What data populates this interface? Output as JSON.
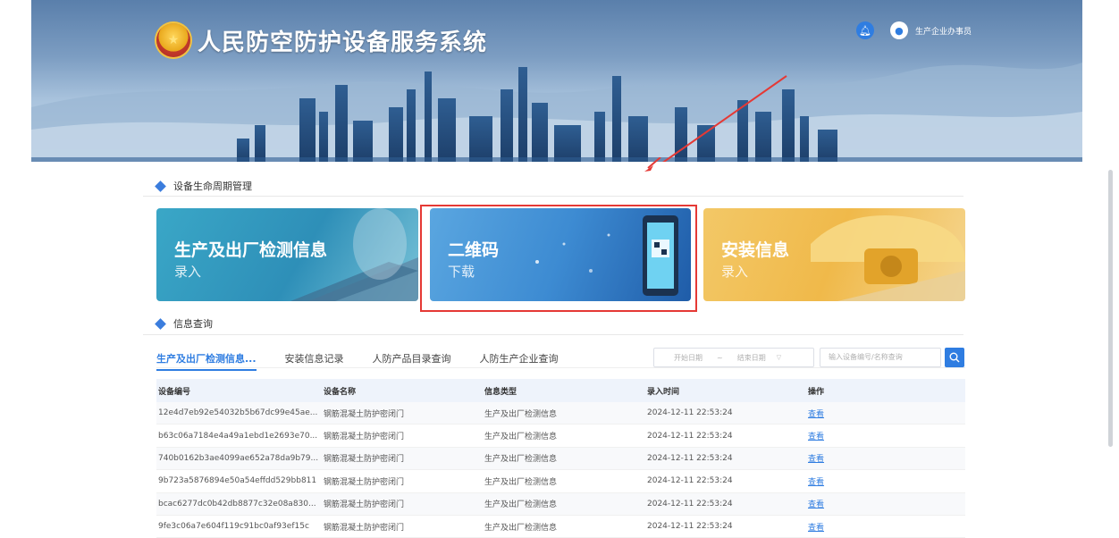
{
  "header": {
    "title": "人民防空防护设备服务系统",
    "user_name": "生产企业办事员"
  },
  "lifecycle": {
    "section_title": "设备生命周期管理",
    "cards": [
      {
        "title": "生产及出厂检测信息",
        "subtitle": "录入"
      },
      {
        "title": "二维码",
        "subtitle": "下载"
      },
      {
        "title": "安装信息",
        "subtitle": "录入"
      }
    ]
  },
  "query": {
    "section_title": "信息查询",
    "tabs": [
      "生产及出厂检测信息...",
      "安装信息记录",
      "人防产品目录查询",
      "人防生产企业查询"
    ],
    "start_date_placeholder": "开始日期",
    "range_separator": "~",
    "end_date_placeholder": "结束日期",
    "search_placeholder": "输入设备编号/名称查询"
  },
  "table": {
    "headers": [
      "设备编号",
      "设备名称",
      "信息类型",
      "录入时间",
      "操作"
    ],
    "rows": [
      [
        "12e4d7eb92e54032b5b67dc99e45ae...",
        "钢筋混凝土防护密闭门",
        "生产及出厂检测信息",
        "2024-12-11 22:53:24",
        "查看"
      ],
      [
        "b63c06a7184e4a49a1ebd1e2693e70...",
        "钢筋混凝土防护密闭门",
        "生产及出厂检测信息",
        "2024-12-11 22:53:24",
        "查看"
      ],
      [
        "740b0162b3ae4099ae652a78da9b79...",
        "钢筋混凝土防护密闭门",
        "生产及出厂检测信息",
        "2024-12-11 22:53:24",
        "查看"
      ],
      [
        "9b723a5876894e50a54effdd529bb811",
        "钢筋混凝土防护密闭门",
        "生产及出厂检测信息",
        "2024-12-11 22:53:24",
        "查看"
      ],
      [
        "bcac6277dc0b42db8877c32e08a830...",
        "钢筋混凝土防护密闭门",
        "生产及出厂检测信息",
        "2024-12-11 22:53:24",
        "查看"
      ],
      [
        "9fe3c06a7e604f119c91bc0af93ef15c",
        "钢筋混凝土防护密闭门",
        "生产及出厂检测信息",
        "2024-12-11 22:53:24",
        "查看"
      ]
    ]
  },
  "colors": {
    "accent": "#2f7de1",
    "highlight_box": "#e53935"
  }
}
